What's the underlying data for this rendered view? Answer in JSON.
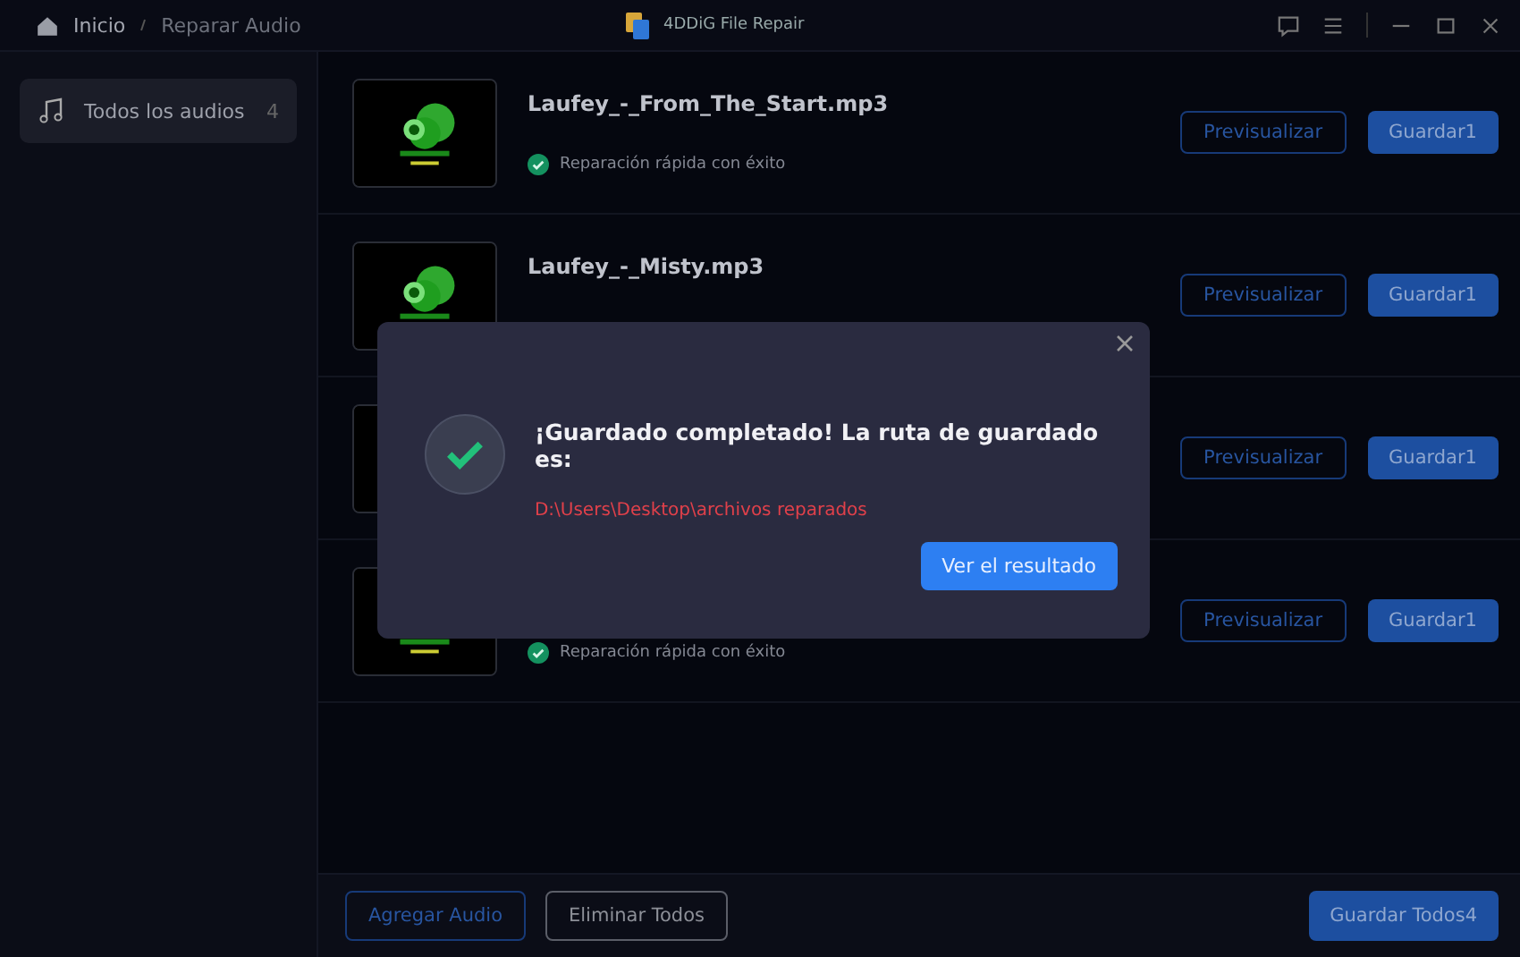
{
  "titlebar": {
    "breadcrumbs": [
      "Inicio",
      "Reparar Audio"
    ],
    "app_title": "4DDiG File Repair"
  },
  "sidebar": {
    "items": [
      {
        "label": "Todos los audios",
        "count": "4",
        "selected": true
      }
    ]
  },
  "files": [
    {
      "name": "Laufey_-_From_The_Start.mp3",
      "status": "Reparación rápida con éxito",
      "preview": "Previsualizar",
      "save": "Guardar1"
    },
    {
      "name": "Laufey_-_Misty.mp3",
      "preview": "Previsualizar",
      "save": "Guardar1"
    },
    {
      "preview": "Previsualizar",
      "save": "Guardar1"
    },
    {
      "status": "Reparación rápida con éxito",
      "preview": "Previsualizar",
      "save": "Guardar1"
    }
  ],
  "footer": {
    "add": "Agregar Audio",
    "remove": "Eliminar Todos",
    "save_all": "Guardar Todos4"
  },
  "dialog": {
    "title": "¡Guardado completado! La ruta de guardado es:",
    "path": "D:\\Users\\Desktop\\archivos reparados",
    "button": "Ver el resultado"
  }
}
